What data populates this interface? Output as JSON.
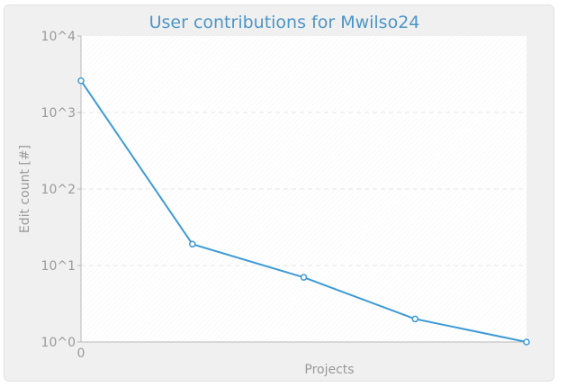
{
  "chart_data": {
    "type": "line",
    "title": "User contributions for Mwilso24",
    "xlabel": "Projects",
    "ylabel": "Edit count [#]",
    "y_scale": "log",
    "ylim": [
      1,
      10000
    ],
    "y_ticks": [
      "10^0",
      "10^1",
      "10^2",
      "10^3",
      "10^4"
    ],
    "x_ticks": [
      "0"
    ],
    "grid": true,
    "colors": {
      "line": "#3e9ad6",
      "title": "#4d95c7",
      "grid": "#e6e6e6"
    },
    "series": [
      {
        "x": [
          0,
          1,
          2,
          3,
          4
        ],
        "values": [
          2600,
          19,
          7,
          2,
          1
        ]
      }
    ]
  }
}
